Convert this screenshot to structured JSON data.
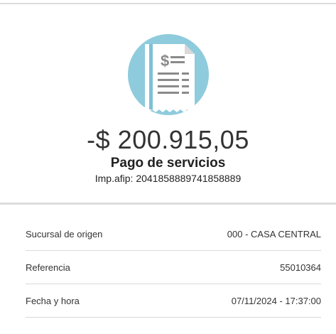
{
  "transaction": {
    "amount": "-$ 200.915,05",
    "type": "Pago de servicios",
    "imp_afip": "Imp.afip: 2041858889741858889",
    "icon": "receipt-dollar-icon"
  },
  "details": [
    {
      "label": "Sucursal de origen",
      "value": "000 - CASA CENTRAL"
    },
    {
      "label": "Referencia",
      "value": "55010364"
    },
    {
      "label": "Fecha y hora",
      "value": "07/11/2024 - 17:37:00"
    }
  ],
  "colors": {
    "icon_circle": "#8ecbdd",
    "divider": "#dcdcdc"
  }
}
